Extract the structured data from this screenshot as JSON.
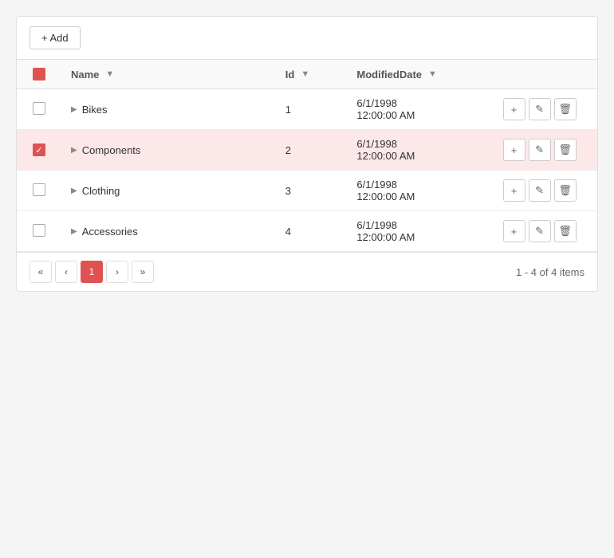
{
  "toolbar": {
    "add_label": "+ Add"
  },
  "table": {
    "headers": {
      "checkbox": "",
      "name": "Name",
      "id": "Id",
      "modified_date": "ModifiedDate",
      "actions": ""
    },
    "rows": [
      {
        "id": 1,
        "name": "Bikes",
        "modified_date": "6/1/1998\n12:00:00 AM",
        "checked": false,
        "selected": false
      },
      {
        "id": 2,
        "name": "Components",
        "modified_date": "6/1/1998\n12:00:00 AM",
        "checked": true,
        "selected": true
      },
      {
        "id": 3,
        "name": "Clothing",
        "modified_date": "6/1/1998\n12:00:00 AM",
        "checked": false,
        "selected": false
      },
      {
        "id": 4,
        "name": "Accessories",
        "modified_date": "6/1/1998\n12:00:00 AM",
        "checked": false,
        "selected": false
      }
    ]
  },
  "pagination": {
    "current_page": 1,
    "total_items": "1 - 4 of 4 items",
    "first_label": "«",
    "prev_label": "‹",
    "next_label": "›",
    "last_label": "»"
  }
}
